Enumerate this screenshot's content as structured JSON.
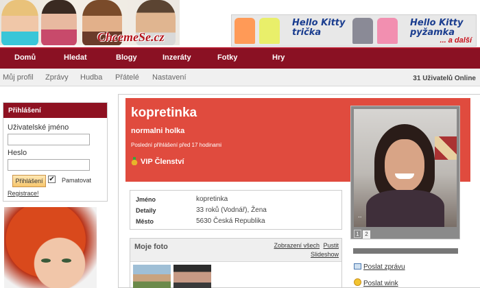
{
  "header": {
    "logo_text": "ChcemeSe.cz",
    "ad": {
      "title1_line1": "Hello Kitty",
      "title1_line2": "trička",
      "title2_line1": "Hello Kitty",
      "title2_line2": "pyžamka",
      "more": "... a další"
    }
  },
  "nav": {
    "items": [
      "Domů",
      "Hledat",
      "Blogy",
      "Inzeráty",
      "Fotky",
      "Hry"
    ]
  },
  "subnav": {
    "items": [
      "Můj profil",
      "Zprávy",
      "Hudba",
      "Přátelé",
      "Nastavení"
    ],
    "online": "31 Uživatelů Online"
  },
  "login": {
    "title": "Přihlášení",
    "username_label": "Uživatelské jméno",
    "password_label": "Heslo",
    "button": "Přihlášení",
    "remember_label": "Pamatovat",
    "remember_checked": true,
    "register_link": "Registrace!"
  },
  "profile": {
    "name": "kopretinka",
    "tagline": "normalni holka",
    "last_login": "Poslední přihlášení před 17 hodinami",
    "vip": "VIP Členství",
    "details": [
      {
        "label": "Jméno",
        "value": "kopretinka"
      },
      {
        "label": "Detaily",
        "value": "33 roků (Vodnář), Žena"
      },
      {
        "label": "Město",
        "value": "5630 Česká Republika"
      }
    ]
  },
  "photos": {
    "title": "Moje foto",
    "link_all": "Zobrazení všech",
    "link_start": "Pustit",
    "link_slideshow": "Slideshow"
  },
  "photo_card": {
    "dots": "..",
    "pages": [
      "1",
      "2"
    ]
  },
  "actions": {
    "send_message": "Poslat zprávu",
    "send_wink": "Poslat wink"
  },
  "colors": {
    "nav_bg": "#8a1123",
    "profile_header_bg": "#e04b3e",
    "login_header_bg": "#8e1121",
    "ad_title": "#1a3d8f"
  }
}
